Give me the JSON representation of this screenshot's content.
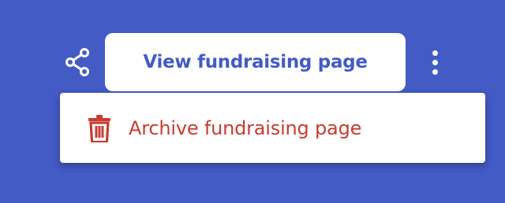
{
  "toolbar": {
    "share_icon": "share-icon",
    "view_button_label": "View fundraising page",
    "more_icon": "more-vertical-icon"
  },
  "menu": {
    "items": [
      {
        "icon": "trash-icon",
        "label": "Archive fundraising page"
      }
    ]
  },
  "colors": {
    "background": "#435bc5",
    "primary_text": "#435bc5",
    "danger": "#c83c32",
    "surface": "#ffffff"
  }
}
